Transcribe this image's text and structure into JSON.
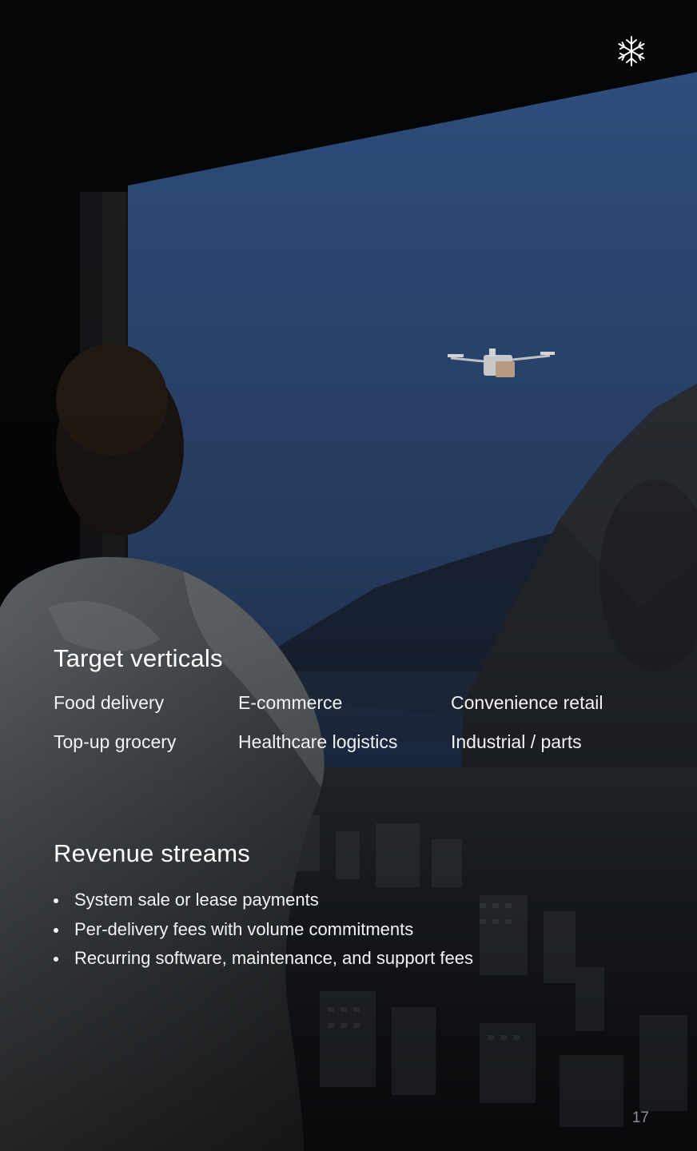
{
  "logo": {
    "icon": "snowflake-icon"
  },
  "target_verticals": {
    "title": "Target verticals",
    "items": [
      "Food delivery",
      "E-commerce",
      "Convenience retail",
      "Top-up grocery",
      "Healthcare logistics",
      "Industrial / parts"
    ]
  },
  "revenue_streams": {
    "title": "Revenue streams",
    "items": [
      "System sale or lease payments",
      "Per-delivery fees with volume commitments",
      "Recurring software, maintenance, and support fees"
    ]
  },
  "page_number": "17",
  "colors": {
    "background": "#050607",
    "sky_top": "#2d4a78",
    "sky_bottom": "#0f1a2a",
    "text": "#ffffff",
    "muted": "#8b9096"
  }
}
